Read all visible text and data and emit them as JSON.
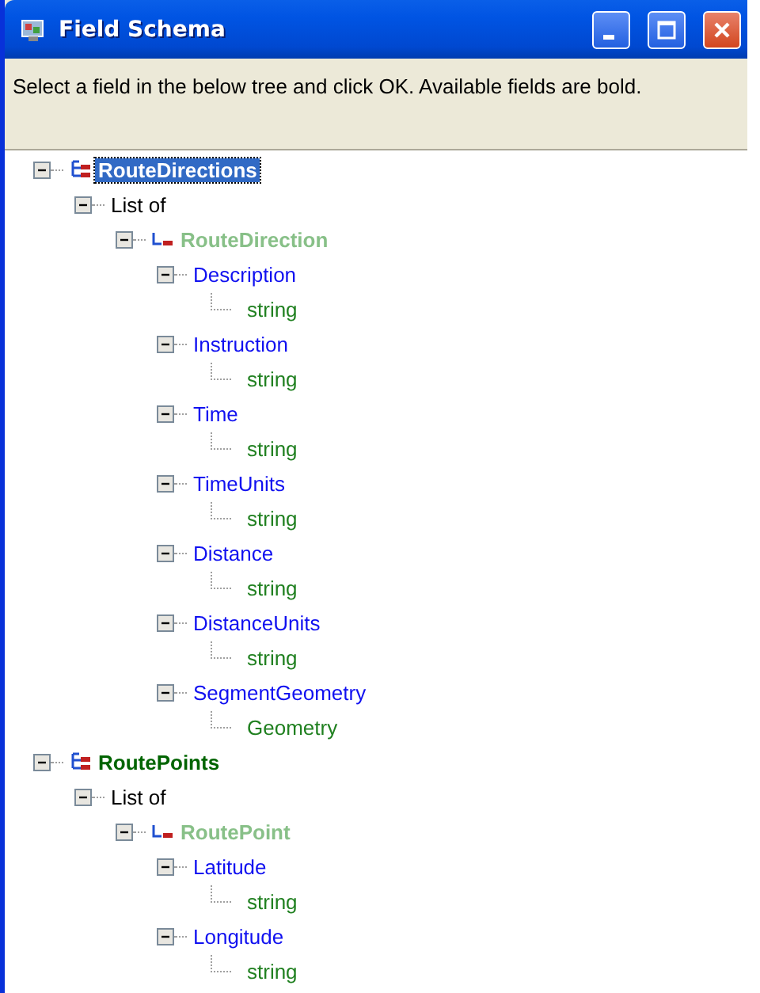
{
  "window": {
    "title": "Field Schema"
  },
  "instructions": "Select a field in the below tree and click OK. Available fields are bold.",
  "tree": [
    {
      "label": "RouteDirections",
      "kind": "object",
      "expanded": true,
      "selected": true,
      "children": [
        {
          "label": "List of",
          "kind": "list",
          "expanded": true,
          "selected": false,
          "children": [
            {
              "label": "RouteDirection",
              "kind": "element",
              "expanded": true,
              "selected": false,
              "children": [
                {
                  "label": "Description",
                  "kind": "field",
                  "expanded": true,
                  "selected": false,
                  "children": [
                    {
                      "label": "string",
                      "kind": "type",
                      "selected": false
                    }
                  ]
                },
                {
                  "label": "Instruction",
                  "kind": "field",
                  "expanded": true,
                  "selected": false,
                  "children": [
                    {
                      "label": "string",
                      "kind": "type",
                      "selected": false
                    }
                  ]
                },
                {
                  "label": "Time",
                  "kind": "field",
                  "expanded": true,
                  "selected": false,
                  "children": [
                    {
                      "label": "string",
                      "kind": "type",
                      "selected": false
                    }
                  ]
                },
                {
                  "label": "TimeUnits",
                  "kind": "field",
                  "expanded": true,
                  "selected": false,
                  "children": [
                    {
                      "label": "string",
                      "kind": "type",
                      "selected": false
                    }
                  ]
                },
                {
                  "label": "Distance",
                  "kind": "field",
                  "expanded": true,
                  "selected": false,
                  "children": [
                    {
                      "label": "string",
                      "kind": "type",
                      "selected": false
                    }
                  ]
                },
                {
                  "label": "DistanceUnits",
                  "kind": "field",
                  "expanded": true,
                  "selected": false,
                  "children": [
                    {
                      "label": "string",
                      "kind": "type",
                      "selected": false
                    }
                  ]
                },
                {
                  "label": "SegmentGeometry",
                  "kind": "field",
                  "expanded": true,
                  "selected": false,
                  "children": [
                    {
                      "label": "Geometry",
                      "kind": "type",
                      "selected": false
                    }
                  ]
                }
              ]
            }
          ]
        }
      ]
    },
    {
      "label": "RoutePoints",
      "kind": "object",
      "expanded": true,
      "selected": false,
      "children": [
        {
          "label": "List of",
          "kind": "list",
          "expanded": true,
          "selected": false,
          "children": [
            {
              "label": "RoutePoint",
              "kind": "element",
              "expanded": true,
              "selected": false,
              "children": [
                {
                  "label": "Latitude",
                  "kind": "field",
                  "expanded": true,
                  "selected": false,
                  "children": [
                    {
                      "label": "string",
                      "kind": "type",
                      "selected": false
                    }
                  ]
                },
                {
                  "label": "Longitude",
                  "kind": "field",
                  "expanded": true,
                  "selected": false,
                  "children": [
                    {
                      "label": "string",
                      "kind": "type",
                      "selected": false
                    }
                  ]
                }
              ]
            }
          ]
        }
      ]
    }
  ]
}
